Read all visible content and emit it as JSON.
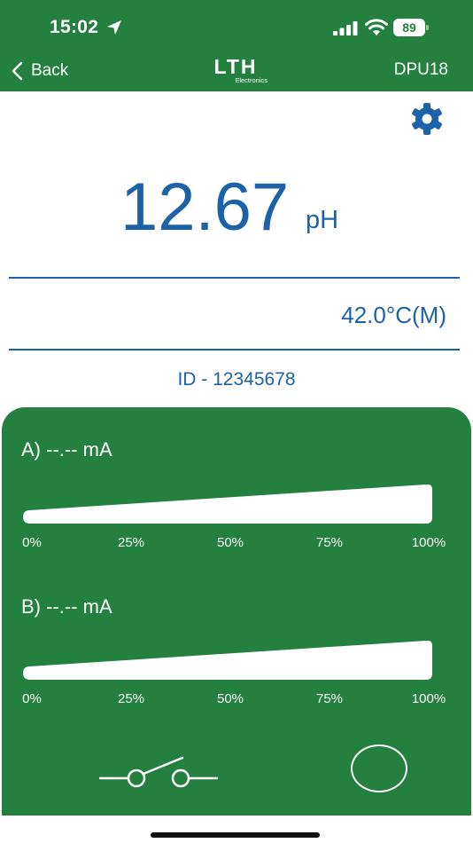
{
  "status_bar": {
    "time": "15:02",
    "battery": "89",
    "location_icon": "location-arrow-icon",
    "signal_icon": "cellular-signal-icon",
    "wifi_icon": "wifi-icon"
  },
  "header": {
    "back_label": "Back",
    "logo_main": "LTH",
    "logo_sub": "Electronics",
    "device": "DPU18"
  },
  "reading": {
    "value": "12.67",
    "unit": "pH"
  },
  "temperature": "42.0°C(M)",
  "device_id": "ID - 12345678",
  "outputs": {
    "channels": [
      {
        "label": "A) --.-- mA",
        "level_percent": 0
      },
      {
        "label": "B) --.-- mA",
        "level_percent": 0
      }
    ],
    "ticks": [
      "0%",
      "25%",
      "50%",
      "75%",
      "100%"
    ]
  },
  "colors": {
    "header_green": "#24803f",
    "reading_blue": "#1c62a8",
    "white": "#ffffff"
  }
}
